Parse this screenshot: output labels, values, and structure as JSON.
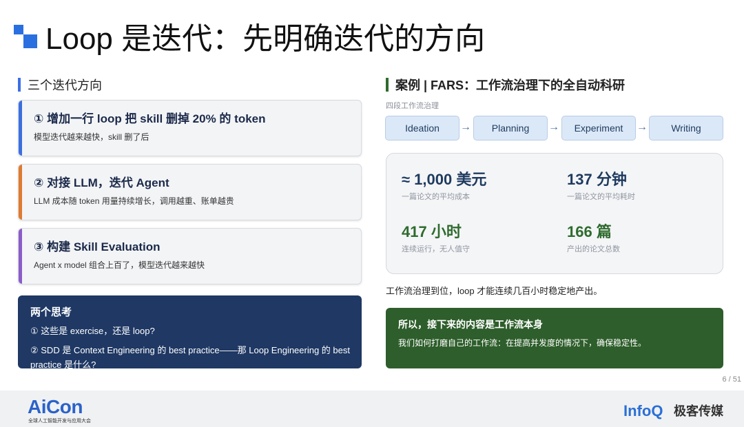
{
  "title": "Loop 是迭代：先明确迭代的方向",
  "left": {
    "heading": "三个迭代方向",
    "cards": [
      {
        "title": "① 增加一行 loop 把 skill 删掉 20% 的 token",
        "sub": "模型迭代越来越快，skill 删了后"
      },
      {
        "title": "② 对接 LLM，迭代 Agent",
        "sub": "LLM 成本随 token 用量持续增长，调用越重、账单越贵"
      },
      {
        "title": "③ 构建 Skill Evaluation",
        "sub": "Agent x model 组合上百了，模型迭代越来越快"
      }
    ],
    "thinking": {
      "title": "两个思考",
      "line1": "① 这些是 exercise，还是 loop?",
      "line2": "② SDD 是 Context Engineering 的 best practice——那 Loop Engineering 的 best practice 是什么?"
    }
  },
  "right": {
    "heading": "案例 | FARS：工作流治理下的全自动科研",
    "flow_caption": "四段工作流治理",
    "steps": [
      "Ideation",
      "Planning",
      "Experiment",
      "Writing"
    ],
    "arrow": "→",
    "stats": [
      {
        "value": "≈ 1,000 美元",
        "label": "一篇论文的平均成本"
      },
      {
        "value": "137 分钟",
        "label": "一篇论文的平均耗时"
      },
      {
        "value": "417 小时",
        "label": "连续运行，无人值守"
      },
      {
        "value": "166 篇",
        "label": "产出的论文总数"
      }
    ],
    "summary": "工作流治理到位，loop 才能连续几百小时稳定地产出。",
    "conclusion": {
      "title": "所以，接下来的内容是工作流本身",
      "body": "我们如何打磨自己的工作流：在提高并发度的情况下，确保稳定性。"
    }
  },
  "page_number": "6 / 51",
  "footer": {
    "aicon_logo": "AiCon",
    "aicon_sub": "全球人工智能开发与应用大会",
    "infoq_logo": "InfoQ",
    "geek_logo": "极客传媒"
  },
  "colors": {
    "accent_blue": "#3b6fe0",
    "accent_orange": "#e07a2e",
    "accent_purple": "#8a5cc9",
    "navy": "#1f3864",
    "green": "#2e5e2b"
  }
}
